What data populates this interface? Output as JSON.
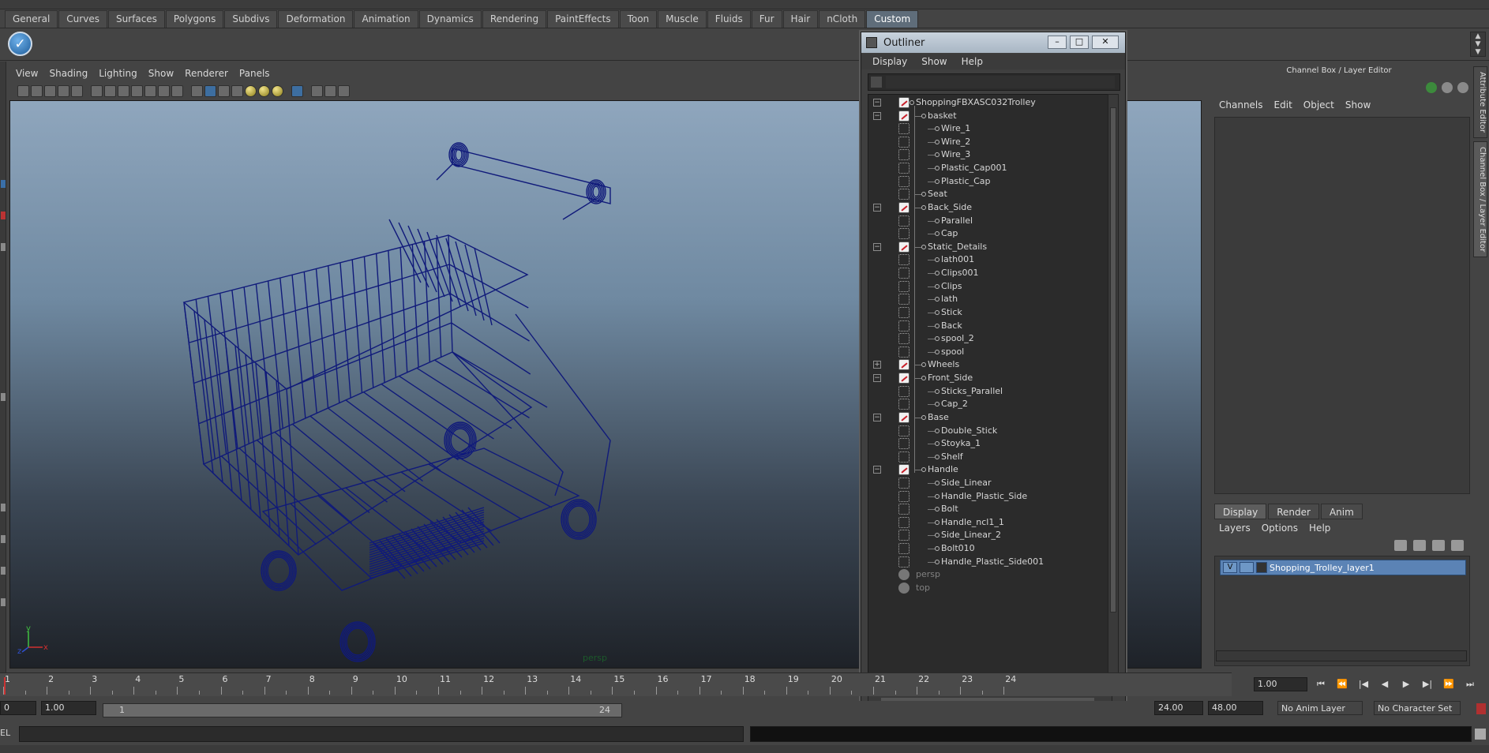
{
  "shelf": {
    "tabs": [
      "General",
      "Curves",
      "Surfaces",
      "Polygons",
      "Subdivs",
      "Deformation",
      "Animation",
      "Dynamics",
      "Rendering",
      "PaintEffects",
      "Toon",
      "Muscle",
      "Fluids",
      "Fur",
      "Hair",
      "nCloth",
      "Custom"
    ],
    "active_tab": "Custom"
  },
  "viewport": {
    "menu": [
      "View",
      "Shading",
      "Lighting",
      "Show",
      "Renderer",
      "Panels"
    ],
    "camera_label": "persp",
    "axis_x": "x",
    "axis_y": "y",
    "axis_z": "z",
    "wire_color": "#101a7a"
  },
  "outliner": {
    "title": "Outliner",
    "menu": [
      "Display",
      "Show",
      "Help"
    ],
    "search_value": "",
    "minimize": "–",
    "maximize": "□",
    "close": "✕",
    "items": [
      {
        "label": "ShoppingFBXASC032Trolley",
        "depth": 0,
        "type": "group",
        "expander": "−"
      },
      {
        "label": "basket",
        "depth": 1,
        "type": "group",
        "expander": "−"
      },
      {
        "label": "Wire_1",
        "depth": 2,
        "type": "mesh",
        "expander": ""
      },
      {
        "label": "Wire_2",
        "depth": 2,
        "type": "mesh",
        "expander": ""
      },
      {
        "label": "Wire_3",
        "depth": 2,
        "type": "mesh",
        "expander": ""
      },
      {
        "label": "Plastic_Cap001",
        "depth": 2,
        "type": "mesh",
        "expander": ""
      },
      {
        "label": "Plastic_Cap",
        "depth": 2,
        "type": "mesh",
        "expander": ""
      },
      {
        "label": "Seat",
        "depth": 1,
        "type": "mesh",
        "expander": ""
      },
      {
        "label": "Back_Side",
        "depth": 1,
        "type": "group",
        "expander": "−"
      },
      {
        "label": "Parallel",
        "depth": 2,
        "type": "mesh",
        "expander": ""
      },
      {
        "label": "Cap",
        "depth": 2,
        "type": "mesh",
        "expander": ""
      },
      {
        "label": "Static_Details",
        "depth": 1,
        "type": "group",
        "expander": "−"
      },
      {
        "label": "lath001",
        "depth": 2,
        "type": "mesh",
        "expander": ""
      },
      {
        "label": "Clips001",
        "depth": 2,
        "type": "mesh",
        "expander": ""
      },
      {
        "label": "Clips",
        "depth": 2,
        "type": "mesh",
        "expander": ""
      },
      {
        "label": "lath",
        "depth": 2,
        "type": "mesh",
        "expander": ""
      },
      {
        "label": "Stick",
        "depth": 2,
        "type": "mesh",
        "expander": ""
      },
      {
        "label": "Back",
        "depth": 2,
        "type": "mesh",
        "expander": ""
      },
      {
        "label": "spool_2",
        "depth": 2,
        "type": "mesh",
        "expander": ""
      },
      {
        "label": "spool",
        "depth": 2,
        "type": "mesh",
        "expander": ""
      },
      {
        "label": "Wheels",
        "depth": 1,
        "type": "group",
        "expander": "+"
      },
      {
        "label": "Front_Side",
        "depth": 1,
        "type": "group",
        "expander": "−"
      },
      {
        "label": "Sticks_Parallel",
        "depth": 2,
        "type": "mesh",
        "expander": ""
      },
      {
        "label": "Cap_2",
        "depth": 2,
        "type": "mesh",
        "expander": ""
      },
      {
        "label": "Base",
        "depth": 1,
        "type": "group",
        "expander": "−"
      },
      {
        "label": "Double_Stick",
        "depth": 2,
        "type": "mesh",
        "expander": ""
      },
      {
        "label": "Stoyka_1",
        "depth": 2,
        "type": "mesh",
        "expander": ""
      },
      {
        "label": "Shelf",
        "depth": 2,
        "type": "mesh",
        "expander": ""
      },
      {
        "label": "Handle",
        "depth": 1,
        "type": "group",
        "expander": "−"
      },
      {
        "label": "Side_Linear",
        "depth": 2,
        "type": "mesh",
        "expander": ""
      },
      {
        "label": "Handle_Plastic_Side",
        "depth": 2,
        "type": "mesh",
        "expander": ""
      },
      {
        "label": "Bolt",
        "depth": 2,
        "type": "mesh",
        "expander": ""
      },
      {
        "label": "Handle_ncl1_1",
        "depth": 2,
        "type": "mesh",
        "expander": ""
      },
      {
        "label": "Side_Linear_2",
        "depth": 2,
        "type": "mesh",
        "expander": ""
      },
      {
        "label": "Bolt010",
        "depth": 2,
        "type": "mesh",
        "expander": ""
      },
      {
        "label": "Handle_Plastic_Side001",
        "depth": 2,
        "type": "mesh",
        "expander": ""
      },
      {
        "label": "persp",
        "depth": 0,
        "type": "camera",
        "expander": ""
      },
      {
        "label": "top",
        "depth": 0,
        "type": "camera",
        "expander": ""
      }
    ]
  },
  "channel_box": {
    "title": "Channel Box / Layer Editor",
    "menu": [
      "Channels",
      "Edit",
      "Object",
      "Show"
    ],
    "side_tabs": [
      "Attribute Editor",
      "Channel Box / Layer Editor"
    ]
  },
  "layer_editor": {
    "tabs": [
      "Display",
      "Render",
      "Anim"
    ],
    "active_tab": "Display",
    "menu": [
      "Layers",
      "Options",
      "Help"
    ],
    "layer": {
      "visible": "V",
      "name": "Shopping_Trolley_layer1"
    }
  },
  "timeline": {
    "ticks": [
      "1",
      "2",
      "3",
      "4",
      "5",
      "6",
      "7",
      "8",
      "9",
      "10",
      "11",
      "12",
      "13",
      "14",
      "15",
      "16",
      "17",
      "18",
      "19",
      "20",
      "21",
      "22",
      "23",
      "24"
    ],
    "current_frame": "1.00",
    "playback_buttons": [
      "⏮",
      "⏪",
      "|◀",
      "◀",
      "▶",
      "▶|",
      "⏩",
      "⏭"
    ]
  },
  "range": {
    "start_field": "0",
    "anim_start": "1.00",
    "range_start": "1",
    "range_end": "24",
    "anim_end": "24.00",
    "max_end": "48.00",
    "anim_layer": "No Anim Layer",
    "character_set": "No Character Set"
  },
  "command": {
    "label": "EL",
    "input": ""
  }
}
